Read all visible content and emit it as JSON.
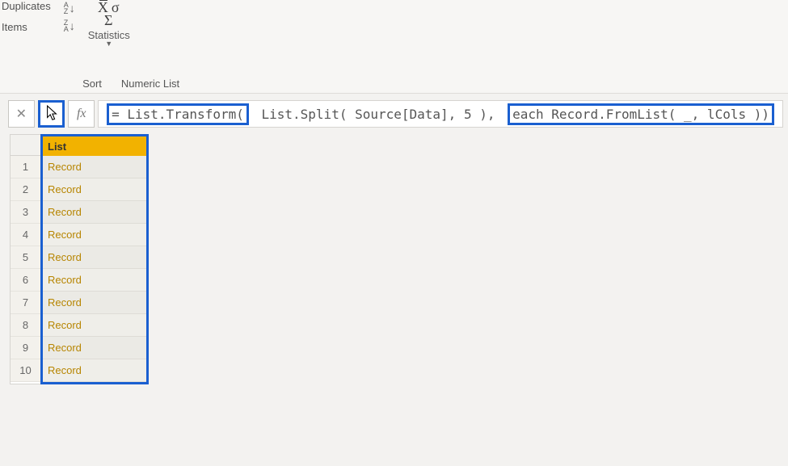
{
  "ribbon": {
    "left_items": [
      "Duplicates",
      "Items"
    ],
    "sort_group_label": "Sort",
    "numlist_group_label": "Numeric List",
    "statistics_label": "Statistics"
  },
  "formula": {
    "part1": "= List.Transform(",
    "part2": " List.Split( Source[Data], 5 ), ",
    "part3": "each Record.FromList( _, lCols ))"
  },
  "list": {
    "header": "List",
    "rows": [
      {
        "n": "1",
        "v": "Record"
      },
      {
        "n": "2",
        "v": "Record"
      },
      {
        "n": "3",
        "v": "Record"
      },
      {
        "n": "4",
        "v": "Record"
      },
      {
        "n": "5",
        "v": "Record"
      },
      {
        "n": "6",
        "v": "Record"
      },
      {
        "n": "7",
        "v": "Record"
      },
      {
        "n": "8",
        "v": "Record"
      },
      {
        "n": "9",
        "v": "Record"
      },
      {
        "n": "10",
        "v": "Record"
      }
    ]
  }
}
